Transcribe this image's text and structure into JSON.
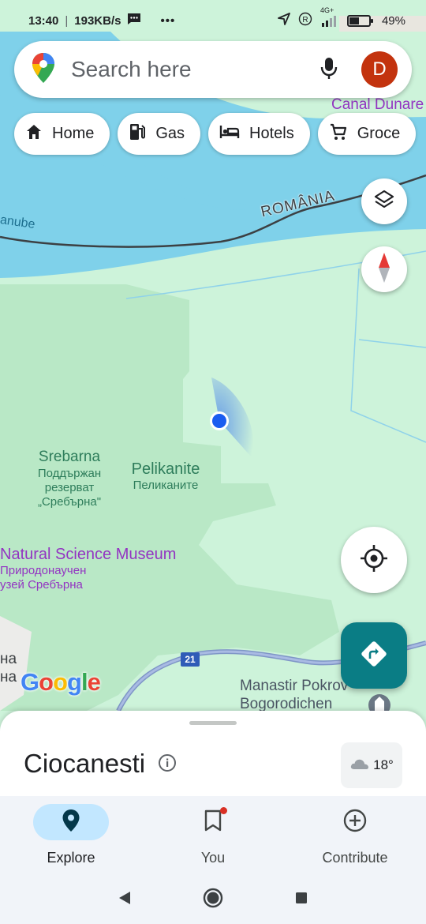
{
  "status_bar": {
    "time": "13:40",
    "speed": "193KB/s",
    "more": "•••",
    "network": "4G+",
    "battery": "49%"
  },
  "search": {
    "placeholder": "Search here",
    "avatar_letter": "D"
  },
  "chips": [
    {
      "label": "Home",
      "icon": "home-icon"
    },
    {
      "label": "Gas",
      "icon": "gas-station-icon"
    },
    {
      "label": "Hotels",
      "icon": "bed-icon"
    },
    {
      "label": "Groce",
      "icon": "cart-icon"
    }
  ],
  "map": {
    "labels": {
      "canal": "Canal Dunare",
      "danube": "anube",
      "romania": "ROMÂNIA",
      "srebarna": "Srebarna",
      "srebarna_bg_1": "Поддържан",
      "srebarna_bg_2": "резерват",
      "srebarna_bg_3": "„Сребърна\"",
      "pelikanite": "Pelikanite",
      "pelikanite_bg": "Пеликаните",
      "museum": "Natural Science Museum",
      "museum_bg_1": "Природонаучен",
      "museum_bg_2": "узей Сребърна",
      "road_number": "21",
      "town_1": "на",
      "town_2": "на",
      "monastery_1": "Manastir Pokrov",
      "monastery_2": "Bogorodichen"
    },
    "colors": {
      "land": "#cdf3da",
      "park": "#b9e8c6",
      "water": "#7fd1ea",
      "border": "#3c4043",
      "road": "#8ea4d1",
      "location": "#1a5cf0"
    }
  },
  "google_logo": {
    "G": "G",
    "o1": "o",
    "o2": "o",
    "g": "g",
    "l": "l",
    "e": "e"
  },
  "sheet": {
    "place_name": "Ciocanesti",
    "temperature": "18°"
  },
  "nav": {
    "items": [
      {
        "label": "Explore",
        "icon": "location-pin-icon",
        "active": true
      },
      {
        "label": "You",
        "icon": "bookmark-icon",
        "active": false
      },
      {
        "label": "Contribute",
        "icon": "add-circle-icon",
        "active": false
      }
    ]
  }
}
